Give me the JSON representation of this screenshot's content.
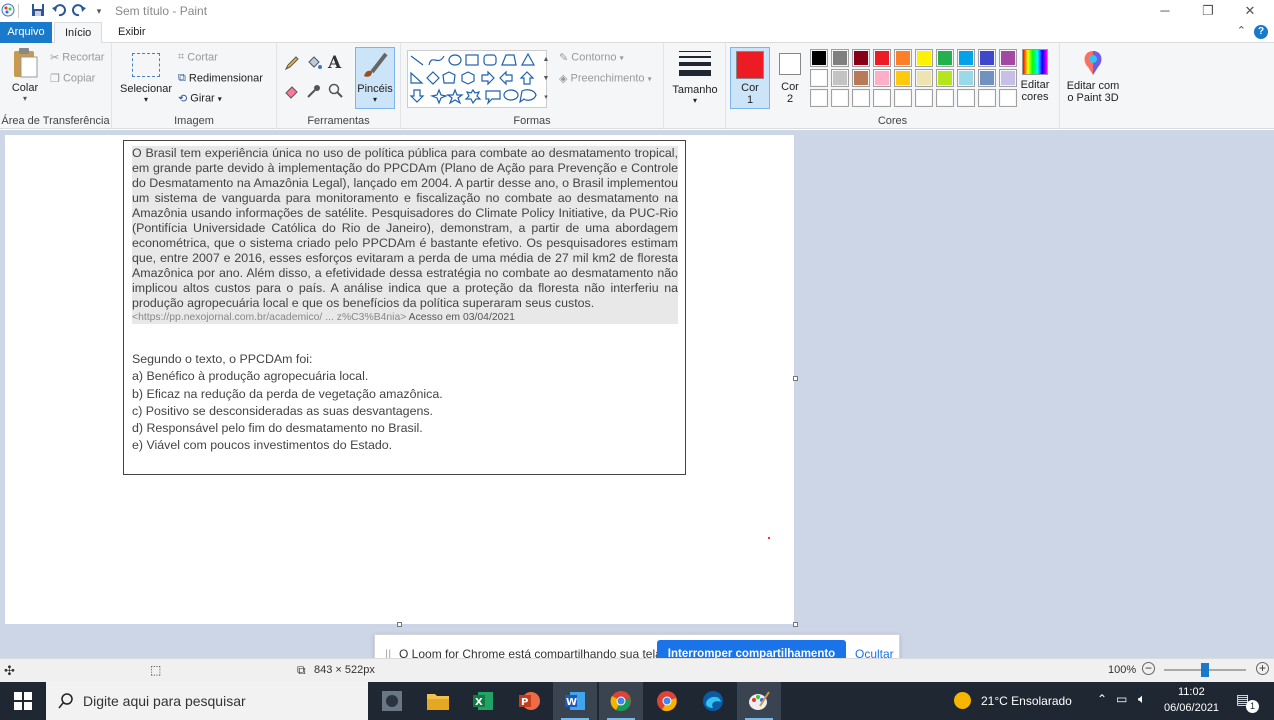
{
  "window": {
    "title": "Sem título - Paint"
  },
  "tabs": {
    "file": "Arquivo",
    "home": "Início",
    "view": "Exibir"
  },
  "ribbon": {
    "clipboard": {
      "label": "Área de Transferência",
      "paste": "Colar",
      "cut": "Recortar",
      "copy": "Copiar"
    },
    "image": {
      "label": "Imagem",
      "select": "Selecionar",
      "crop": "Cortar",
      "resize": "Redimensionar",
      "rotate": "Girar"
    },
    "tools": {
      "label": "Ferramentas",
      "brushes": "Pincéis"
    },
    "shapes": {
      "label": "Formas",
      "outline": "Contorno",
      "fill": "Preenchimento"
    },
    "size": {
      "label": "Tamanho"
    },
    "colors": {
      "label": "Cores",
      "color1_label": "Cor\n1",
      "color1_line1": "Cor",
      "color1_line2": "1",
      "color2_line1": "Cor",
      "color2_line2": "2",
      "color1": "#ed1c24",
      "color2": "#ffffff",
      "edit_line1": "Editar",
      "edit_line2": "cores",
      "paint3d_line1": "Editar com",
      "paint3d_line2": "o Paint 3D",
      "palette_row1": [
        "#000000",
        "#7f7f7f",
        "#880015",
        "#ed1c24",
        "#ff7f27",
        "#fff200",
        "#22b14c",
        "#00a2e8",
        "#3f48cc",
        "#a349a4"
      ],
      "palette_row2": [
        "#ffffff",
        "#c3c3c3",
        "#b97a57",
        "#ffaec9",
        "#ffc90e",
        "#efe4b0",
        "#b5e61d",
        "#99d9ea",
        "#7092be",
        "#c8bfe7"
      ]
    }
  },
  "document": {
    "paragraph": "O Brasil tem experiência única no uso de política pública para combate ao desmatamento tropical, em grande parte devido à implementação do PPCDAm (Plano de Ação para Prevenção e Controle do Desmatamento na Amazônia Legal), lançado em 2004. A partir desse ano, o Brasil implementou um sistema de vanguarda para monitoramento e fiscalização no combate ao desmatamento na Amazônia usando informações de satélite. Pesquisadores do Climate Policy Initiative, da PUC-Rio (Pontifícia Universidade Católica do Rio de Janeiro), demonstram, a partir de uma abordagem econométrica, que o sistema criado pelo PPCDAm é bastante efetivo. Os pesquisadores estimam que, entre 2007 e 2016, esses esforços evitaram a perda de uma média de 27 mil km2 de floresta Amazônica por ano. Além disso, a efetividade dessa estratégia no combate ao desmatamento não implicou altos custos para o país. A análise indica que a proteção da floresta não interferiu na produção agropecuária local e que os benefícios da política superaram seus custos.",
    "source_url": "<https://pp.nexojornal.com.br/academico/ ... z%C3%B4nia>",
    "source_access": "Acesso em 03/04/2021",
    "question": "Segundo o texto, o PPCDAm foi:",
    "options": [
      "a) Benéfico à produção agropecuária local.",
      "b) Eficaz na redução da perda de vegetação amazônica.",
      "c) Positivo se desconsideradas as suas desvantagens.",
      "d) Responsável pelo fim do desmatamento no Brasil.",
      "e) Viável com poucos investimentos do Estado."
    ]
  },
  "loom": {
    "message": "O Loom for Chrome está compartilhando sua tela.",
    "stop": "Interromper compartilhamento",
    "hide": "Ocultar"
  },
  "status": {
    "canvas_size": "843 × 522px",
    "zoom": "100%",
    "zoom_fraction": 0.5
  },
  "taskbar": {
    "search_placeholder": "Digite aqui para pesquisar",
    "weather": "21°C  Ensolarado",
    "time": "11:02",
    "date": "06/06/2021",
    "notifications": "1"
  }
}
